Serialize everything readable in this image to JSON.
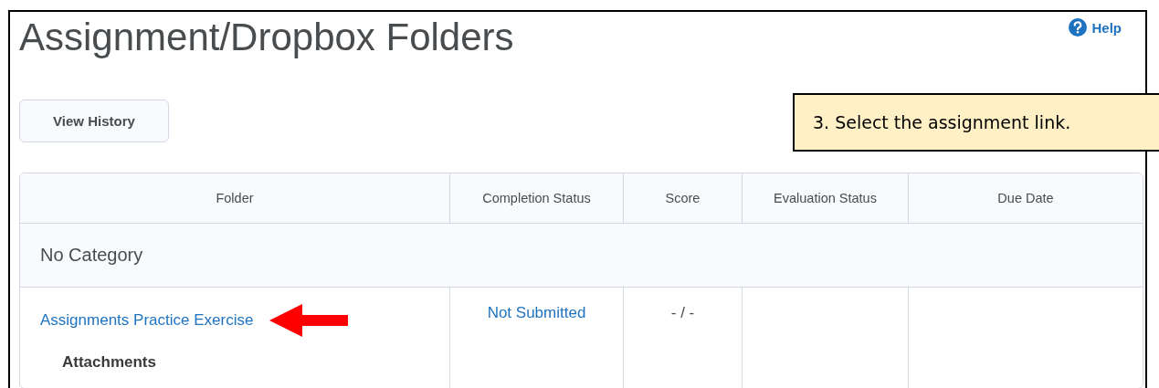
{
  "page": {
    "title": "Assignment/Dropbox Folders",
    "help": "Help",
    "history_button": "View History"
  },
  "callout": {
    "text": "3. Select the assignment link."
  },
  "table": {
    "columns": [
      "Folder",
      "Completion Status",
      "Score",
      "Evaluation Status",
      "Due Date"
    ],
    "category": "No Category",
    "rows": [
      {
        "folder": "Assignments Practice Exercise",
        "attachments": "Attachments",
        "completion_status": "Not Submitted",
        "score": "- / -"
      }
    ]
  }
}
